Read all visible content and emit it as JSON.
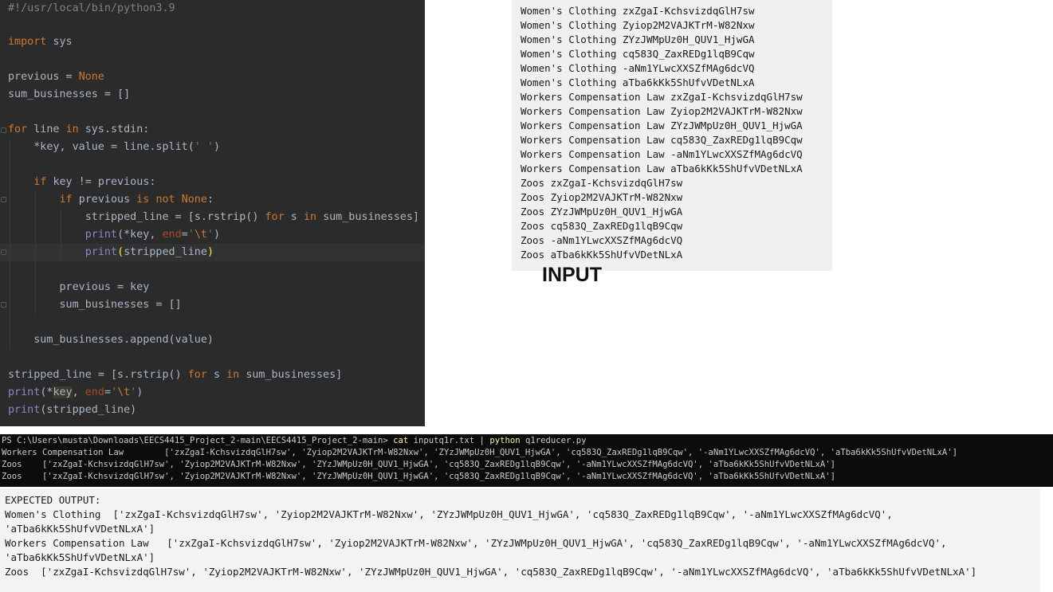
{
  "code": {
    "shebang": "#!/usr/local/bin/python3.9",
    "import_kw": "import",
    "import_mod": "sys",
    "prev_var": "previous",
    "eq": " = ",
    "none_kw": "None",
    "sum_var": "sum_businesses",
    "empty_list": "[]",
    "for_kw": "for",
    "line_var": "line",
    "in_kw": "in",
    "sys_stdin": "sys.stdin:",
    "split_line": "*key, value = line.split(",
    "split_arg": "' '",
    "close_paren": ")",
    "if_kw": "if",
    "key_ne_prev": "key != previous:",
    "is_kw": "is",
    "not_kw": "not",
    "colon": ":",
    "stripped_var": "stripped_line",
    "list_open": "[s.rstrip()",
    "s_var": "s",
    "sum_close": "sum_businesses]",
    "print_fn": "print",
    "star_key": "(*key, ",
    "end_kw": "end",
    "eq2": "=",
    "tab_open": "'",
    "tab_esc": "\\t",
    "tab_close": "'",
    "print_arg_open": "(",
    "stripped_arg": "stripped_line",
    "prev_eq_key": "previous = key",
    "append_line": "sum_businesses.append(value)",
    "star": "(*",
    "key_word": "key",
    "comma_sp": ", ",
    "print_stripped": "(stripped_line)"
  },
  "input_lines": [
    "Women's Clothing zxZgaI-KchsvizdqGlH7sw",
    "Women's Clothing Zyiop2M2VAJKTrM-W82Nxw",
    "Women's Clothing ZYzJWMpUz0H_QUV1_HjwGA",
    "Women's Clothing cq583Q_ZaxREDg1lqB9Cqw",
    "Women's Clothing -aNm1YLwcXXSZfMAg6dcVQ",
    "Women's Clothing aTba6kKk5ShUfvVDetNLxA",
    "Workers Compensation Law zxZgaI-KchsvizdqGlH7sw",
    "Workers Compensation Law Zyiop2M2VAJKTrM-W82Nxw",
    "Workers Compensation Law ZYzJWMpUz0H_QUV1_HjwGA",
    "Workers Compensation Law cq583Q_ZaxREDg1lqB9Cqw",
    "Workers Compensation Law -aNm1YLwcXXSZfMAg6dcVQ",
    "Workers Compensation Law aTba6kKk5ShUfvVDetNLxA",
    "Zoos zxZgaI-KchsvizdqGlH7sw",
    "Zoos Zyiop2M2VAJKTrM-W82Nxw",
    "Zoos ZYzJWMpUz0H_QUV1_HjwGA",
    "Zoos cq583Q_ZaxREDg1lqB9Cqw",
    "Zoos -aNm1YLwcXXSZfMAg6dcVQ",
    "Zoos aTba6kKk5ShUfvVDetNLxA"
  ],
  "input_label": "INPUT",
  "terminal": {
    "prompt": "PS C:\\Users\\musta\\Downloads\\EECS4415_Project_2-main\\EECS4415_Project_2-main> ",
    "cmd_cat": "cat",
    "cmd_file": " inputq1r.txt | ",
    "cmd_python": "python",
    "cmd_script": " q1reducer.py",
    "rows": [
      "Workers Compensation Law        ['zxZgaI-KchsvizdqGlH7sw', 'Zyiop2M2VAJKTrM-W82Nxw', 'ZYzJWMpUz0H_QUV1_HjwGA', 'cq583Q_ZaxREDg1lqB9Cqw', '-aNm1YLwcXXSZfMAg6dcVQ', 'aTba6kKk5ShUfvVDetNLxA']",
      "Zoos    ['zxZgaI-KchsvizdqGlH7sw', 'Zyiop2M2VAJKTrM-W82Nxw', 'ZYzJWMpUz0H_QUV1_HjwGA', 'cq583Q_ZaxREDg1lqB9Cqw', '-aNm1YLwcXXSZfMAg6dcVQ', 'aTba6kKk5ShUfvVDetNLxA']",
      "Zoos    ['zxZgaI-KchsvizdqGlH7sw', 'Zyiop2M2VAJKTrM-W82Nxw', 'ZYzJWMpUz0H_QUV1_HjwGA', 'cq583Q_ZaxREDg1lqB9Cqw', '-aNm1YLwcXXSZfMAg6dcVQ', 'aTba6kKk5ShUfvVDetNLxA']"
    ]
  },
  "expected": {
    "heading": "EXPECTED OUTPUT:",
    "lines": [
      "Women's Clothing  ['zxZgaI-KchsvizdqGlH7sw', 'Zyiop2M2VAJKTrM-W82Nxw', 'ZYzJWMpUz0H_QUV1_HjwGA', 'cq583Q_ZaxREDg1lqB9Cqw', '-aNm1YLwcXXSZfMAg6dcVQ',",
      "'aTba6kKk5ShUfvVDetNLxA']",
      "Workers Compensation Law   ['zxZgaI-KchsvizdqGlH7sw', 'Zyiop2M2VAJKTrM-W82Nxw', 'ZYzJWMpUz0H_QUV1_HjwGA', 'cq583Q_ZaxREDg1lqB9Cqw', '-aNm1YLwcXXSZfMAg6dcVQ',",
      "'aTba6kKk5ShUfvVDetNLxA']",
      "Zoos  ['zxZgaI-KchsvizdqGlH7sw', 'Zyiop2M2VAJKTrM-W82Nxw', 'ZYzJWMpUz0H_QUV1_HjwGA', 'cq583Q_ZaxREDg1lqB9Cqw', '-aNm1YLwcXXSZfMAg6dcVQ', 'aTba6kKk5ShUfvVDetNLxA']"
    ]
  },
  "colors": {
    "editor_bg": "#2b2b2b",
    "keyword": "#cc7832",
    "builtin": "#8888c6",
    "string": "#6a8759",
    "param": "#aa4926",
    "comment": "#808080",
    "terminal_bg": "#0c0c0c",
    "terminal_cmd": "#f9f1a5"
  }
}
